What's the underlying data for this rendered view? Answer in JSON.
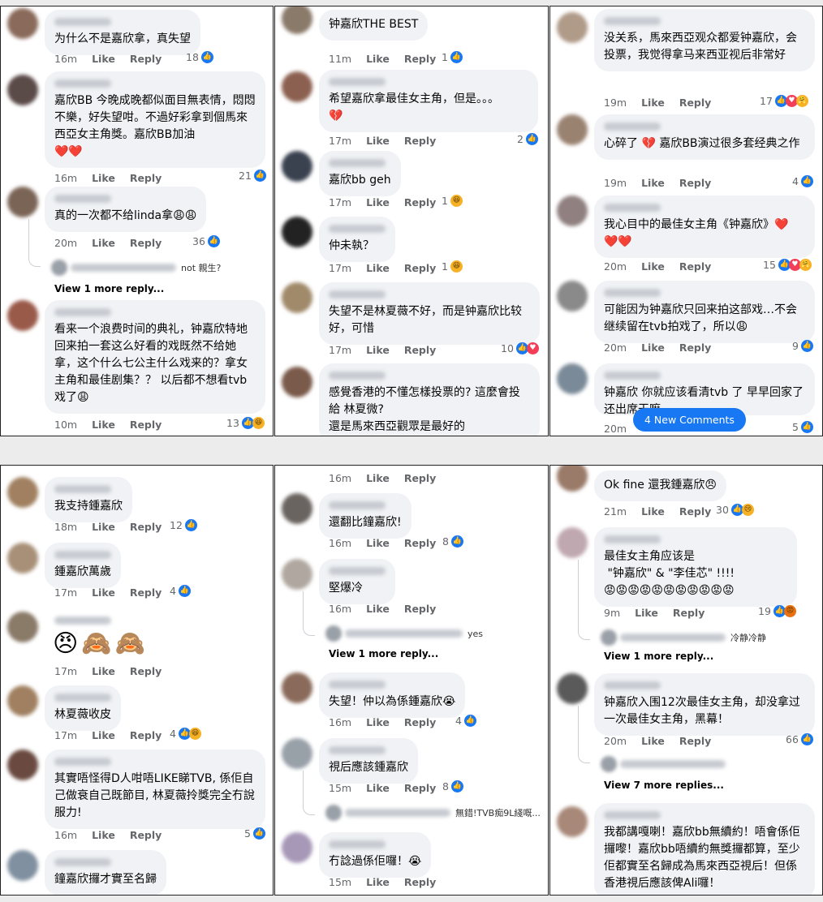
{
  "labels": {
    "like": "Like",
    "reply": "Reply"
  },
  "panel1": {
    "comments": [
      {
        "text": "为什么不是嘉欣拿，真失望",
        "time": "16m",
        "count": "18"
      },
      {
        "text": "嘉欣BB 今晚成晚都似面目無表情，悶悶不樂，好失望咁。不過好彩拿到個馬來西亞女主角獎。嘉欣BB加油\n❤️❤️",
        "time": "16m",
        "count": "21"
      },
      {
        "text": "真的一次都不给linda拿😩😩",
        "time": "20m",
        "count": "36"
      },
      {
        "text": "看来一个浪费时间的典礼，钟嘉欣特地回来拍一套这么好看的戏既然不给她拿，这个什么七公主什么戏来的？拿女主角和最佳剧集？？ 以后都不想看tvb戏了😩",
        "time": "10m",
        "count": "13"
      }
    ],
    "reply_preview": "not 親生?",
    "more_link": "View 1 more reply..."
  },
  "panel2": {
    "comments": [
      {
        "text": "钟嘉欣THE BEST",
        "time": "11m",
        "count": "1"
      },
      {
        "text": "希望嘉欣拿最佳女主角，但是。。。\n💔",
        "time": "17m",
        "count": "2"
      },
      {
        "text": "嘉欣bb geh",
        "time": "17m",
        "count": "1"
      },
      {
        "text": "仲未執？",
        "time": "17m",
        "count": "1"
      },
      {
        "text": "失望不是林夏薇不好，而是钟嘉欣比较好，可惜",
        "time": "17m",
        "count": "10"
      },
      {
        "text": "感覺香港的不懂怎樣投票的? 這麼會投給 林夏微?\n還是馬來西亞觀眾是最好的",
        "time": "",
        "count": ""
      }
    ]
  },
  "panel3": {
    "comments": [
      {
        "text": "没关系，馬來西亞观众都爱钟嘉欣，会投票，我觉得拿马来西亚视后非常好",
        "time": "19m",
        "count": "17"
      },
      {
        "text": "心碎了 💔 嘉欣BB演过很多套经典之作",
        "time": "19m",
        "count": "4"
      },
      {
        "text": "我心目中的最佳女主角《钟嘉欣》❤️\n❤️❤️",
        "time": "20m",
        "count": "15"
      },
      {
        "text": "可能因为钟嘉欣只回来拍这部戏…不会继续留在tvb拍戏了，所以😩",
        "time": "20m",
        "count": "9"
      },
      {
        "text": "钟嘉欣 你就应该看清tvb 了 早早回家了 还出席干嘛",
        "time": "20m",
        "count": "5"
      }
    ],
    "new_comments": "4 New Comments"
  },
  "panel4": {
    "comments": [
      {
        "text": "我支持鍾嘉欣",
        "time": "18m",
        "count": "12"
      },
      {
        "text": "鍾嘉欣萬歲",
        "time": "17m",
        "count": "4"
      },
      {
        "text": "😠🙈🙈",
        "time": "17m",
        "count": ""
      },
      {
        "text": "林夏薇收皮",
        "time": "17m",
        "count": "4"
      },
      {
        "text": "其實唔怪得D人咁唔LIKE睇TVB, 係佢自己做衰自己既節目, 林夏薇拎獎完全冇說服力!",
        "time": "16m",
        "count": "5"
      },
      {
        "text": "鐘嘉欣攞才實至名歸",
        "time": "",
        "count": ""
      }
    ]
  },
  "panel5": {
    "top_time": "16m",
    "comments": [
      {
        "text": "還翻比鐘嘉欣!",
        "time": "16m",
        "count": "8"
      },
      {
        "text": "堅爆冷",
        "time": "16m",
        "count": ""
      },
      {
        "text": "失望！仲以為係鍾嘉欣😭",
        "time": "16m",
        "count": "4"
      },
      {
        "text": "視后應該鍾嘉欣",
        "time": "15m",
        "count": "8"
      },
      {
        "text": "冇諗過係佢囉！😭",
        "time": "15m",
        "count": ""
      }
    ],
    "reply1": "yes",
    "more1": "View 1 more reply...",
    "reply2": "無錯!TVB痴9L綫嘅..."
  },
  "panel6": {
    "comments": [
      {
        "text": "Ok fine 還我鍾嘉欣😠",
        "time": "21m",
        "count": "30"
      },
      {
        "text": "最佳女主角应该是\n \"钟嘉欣\" & \"李佳芯\" !!!!\n😡😡😡😡😡😡😡😡😡😡😡",
        "time": "9m",
        "count": "19"
      },
      {
        "text": "钟嘉欣入围12次最佳女主角，却没拿过一次最佳女主角，黑幕！",
        "time": "20m",
        "count": "66"
      },
      {
        "text": "我都講嘎喇！嘉欣bb無續約！唔會係佢攞嚟！嘉欣bb唔續約無獎攞都算，至少佢都實至名歸成為馬來西亞視后！但係香港視后應該俾Ali囉！",
        "time": "",
        "count": ""
      }
    ],
    "reply1": "冷静冷静",
    "more1": "View 1 more reply...",
    "more2": "View 7 more replies..."
  }
}
